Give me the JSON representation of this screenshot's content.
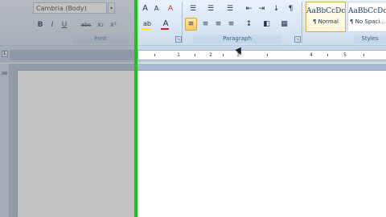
{
  "ribbon": {
    "font": {
      "font_name": "Cambria (Body)",
      "dropdown_arrow": "▾",
      "group_label": "Font",
      "bold": "B",
      "italic": "I",
      "underline": "U",
      "strikethrough": "abc",
      "subscript": "x₂",
      "superscript": "x²",
      "grow_font": "A",
      "shrink_font": "A",
      "clear_formatting": "A",
      "highlight": "ab",
      "font_color": "A",
      "font_color_hex": "#d81e1e",
      "highlight_color_hex": "#ffea00"
    },
    "paragraph": {
      "group_label": "Paragraph",
      "bullets": "☰",
      "numbering": "☰",
      "multilevel": "☰",
      "decrease_indent": "⇤",
      "increase_indent": "⇥",
      "sort": "↓",
      "show_marks": "¶",
      "align_left": "≡",
      "align_center": "≡",
      "align_right": "≡",
      "justify": "≡",
      "line_spacing": "↕",
      "shading": "◧",
      "borders": "▦"
    },
    "styles": {
      "group_label": "Styles",
      "items": [
        {
          "preview": "AaBbCcDc",
          "name": "¶ Normal"
        },
        {
          "preview": "AaBbCcDc",
          "name": "¶ No Spaci..."
        }
      ]
    },
    "launcher": "↘"
  },
  "ruler": {
    "numbers": [
      "1",
      "2",
      "3",
      "4",
      "5"
    ],
    "tab_marker": "L"
  },
  "colors": {
    "divider": "#1ec21e",
    "ribbon_bg": "#dbe7f5",
    "doc_bg": "#a8bad1"
  }
}
